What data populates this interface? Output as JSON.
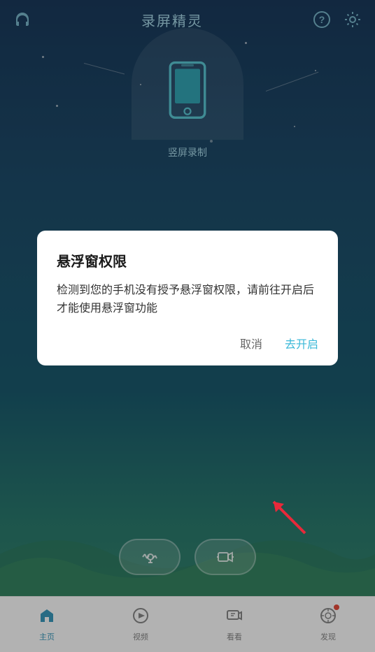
{
  "app": {
    "title": "录屏精灵",
    "colors": {
      "bg_top": "#1a3a5c",
      "bg_bottom": "#3a8a6a",
      "accent": "#3ab8d8"
    }
  },
  "top_bar": {
    "title": "录屏精灵",
    "help_icon": "?",
    "settings_icon": "⚙"
  },
  "phone_section": {
    "label": "竖屏录制"
  },
  "bottom_buttons": {
    "audio_btn": "音频录制",
    "video_btn": "视频录制"
  },
  "dialog": {
    "title": "悬浮窗权限",
    "body": "检测到您的手机没有授予悬浮窗权限，请前往开启后才能使用悬浮窗功能",
    "cancel_label": "取消",
    "confirm_label": "去开启"
  },
  "bottom_nav": {
    "items": [
      {
        "label": "主页",
        "active": true
      },
      {
        "label": "视频",
        "active": false
      },
      {
        "label": "看看",
        "active": false
      },
      {
        "label": "发现",
        "active": false,
        "badge": true
      }
    ]
  }
}
